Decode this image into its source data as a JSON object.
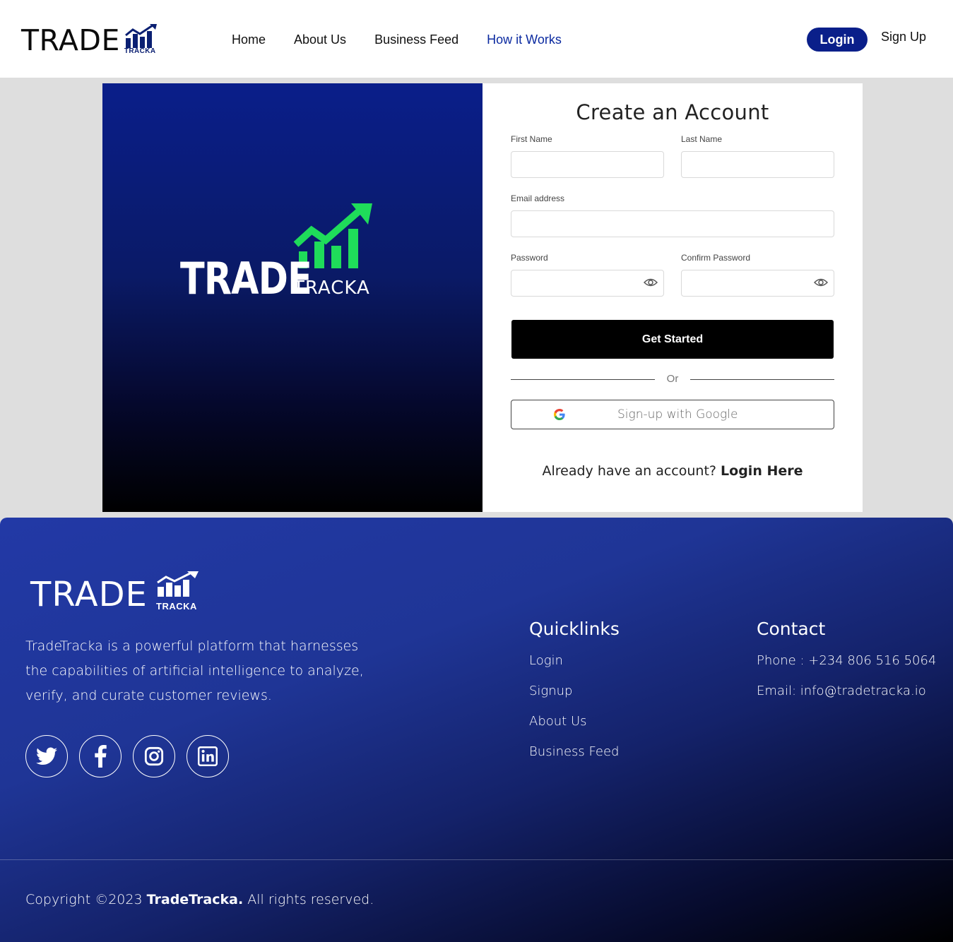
{
  "header": {
    "logo_text": "TRADE",
    "logo_sub": "TRACKA",
    "nav": [
      {
        "label": "Home"
      },
      {
        "label": "About Us"
      },
      {
        "label": "Business Feed"
      },
      {
        "label": "How it Works"
      }
    ],
    "login_label": "Login",
    "signup_label": "Sign Up"
  },
  "hero": {
    "logo_text": "TRADE",
    "logo_sub": "TRACKA"
  },
  "form": {
    "title": "Create an Account",
    "first_name_label": "First Name",
    "last_name_label": "Last Name",
    "email_label": "Email address",
    "password_label": "Password",
    "confirm_password_label": "Confirm Password",
    "first_name_value": "",
    "last_name_value": "",
    "email_value": "",
    "password_value": "",
    "confirm_password_value": "",
    "submit_label": "Get Started",
    "or_text": "Or",
    "google_label": "Sign-up with Google",
    "have_account_text": "Already have an account?",
    "login_here_label": "Login Here"
  },
  "footer": {
    "logo_text": "TRADE",
    "logo_sub": "TRACKA",
    "description": "TradeTracka is a powerful platform that harnesses the capabilities of artificial intelligence to analyze, verify, and curate customer reviews.",
    "socials": [
      "twitter-icon",
      "facebook-icon",
      "instagram-icon",
      "linkedin-icon"
    ],
    "quicklinks_title": "Quicklinks",
    "quicklinks": [
      {
        "label": "Login"
      },
      {
        "label": "Signup"
      },
      {
        "label": "About Us"
      },
      {
        "label": "Business Feed"
      }
    ],
    "contact_title": "Contact",
    "phone": "Phone : +234 806 516 5064",
    "email": "Email: info@tradetracka.io",
    "copyright_prefix": "Copyright ©2023",
    "copyright_brand": "TradeTracka.",
    "copyright_suffix": "All rights reserved."
  },
  "colors": {
    "brand_navy": "#0a1f8a",
    "accent_green": "#1fdc5a",
    "active_nav": "#0b2aa0",
    "footer_top": "#2239a6"
  }
}
